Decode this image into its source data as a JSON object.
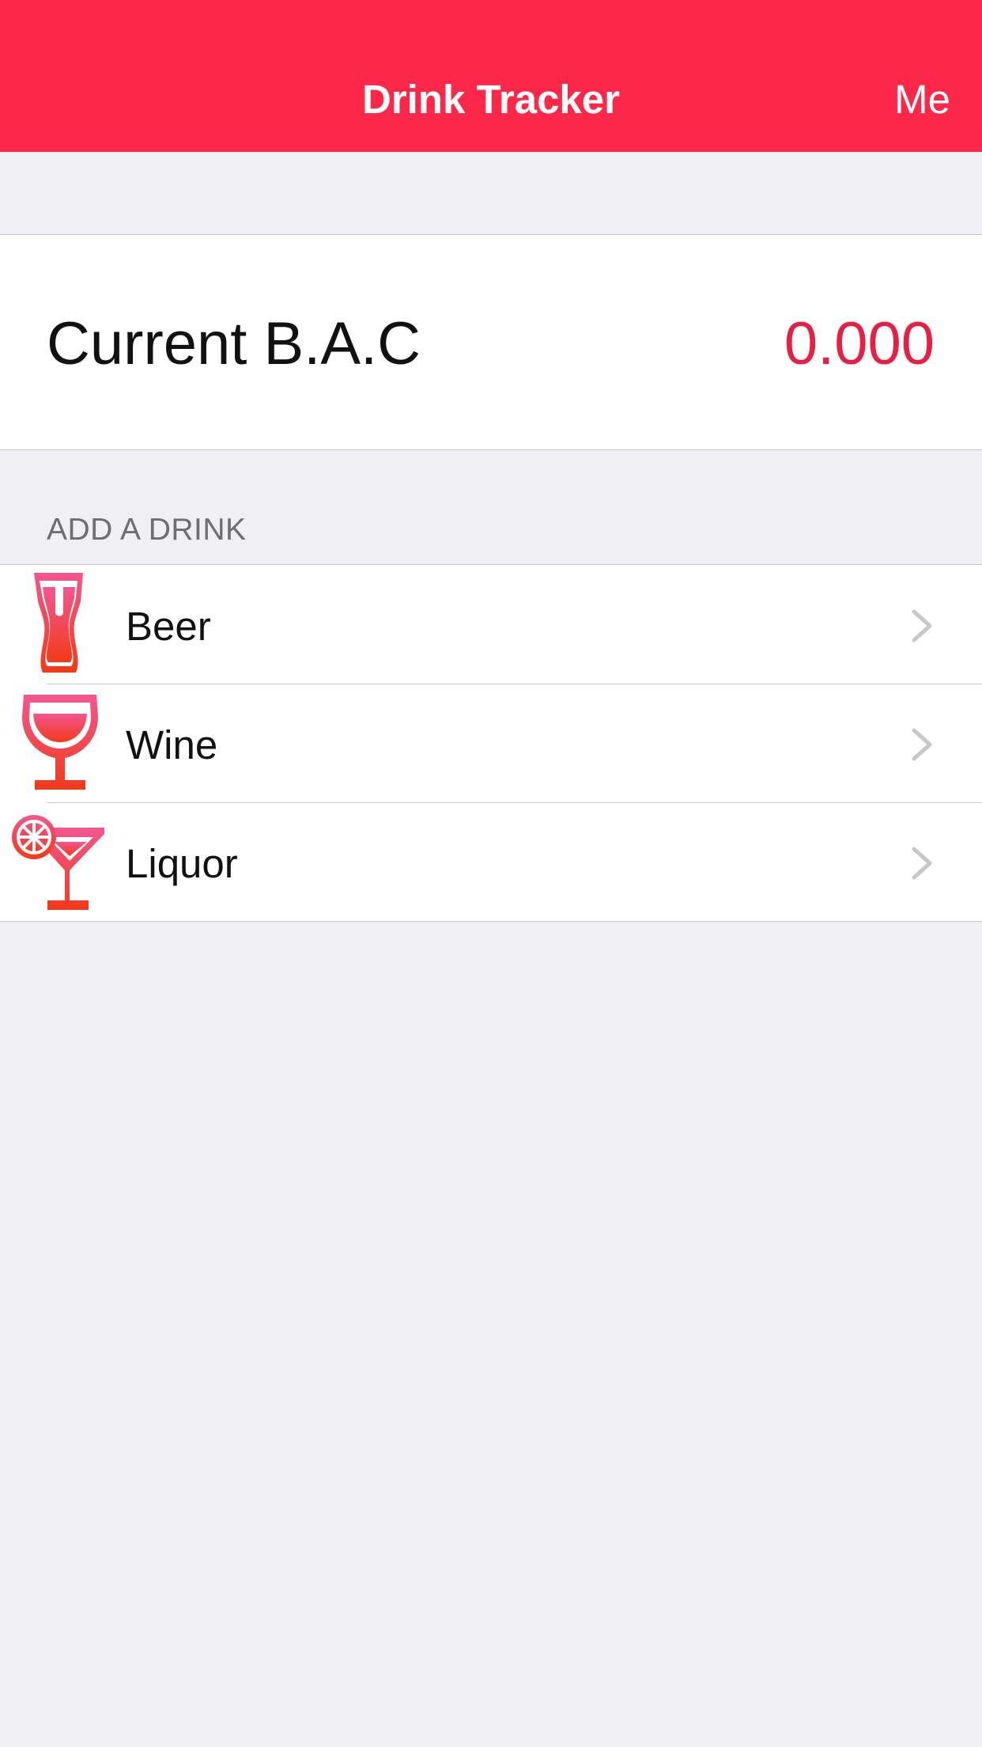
{
  "nav": {
    "title": "Drink Tracker",
    "right_button": "Me",
    "color": "#fd2749"
  },
  "bac": {
    "label": "Current B.A.C",
    "value": "0.000",
    "value_color": "#e61f45"
  },
  "section": {
    "header": "ADD A DRINK"
  },
  "drinks": [
    {
      "label": "Beer",
      "icon": "beer-glass-icon"
    },
    {
      "label": "Wine",
      "icon": "wine-glass-icon"
    },
    {
      "label": "Liquor",
      "icon": "cocktail-glass-icon"
    }
  ],
  "colors": {
    "background": "#efeff4",
    "icon_gradient_top": "#f2578f",
    "icon_gradient_bottom": "#f23a1a"
  }
}
